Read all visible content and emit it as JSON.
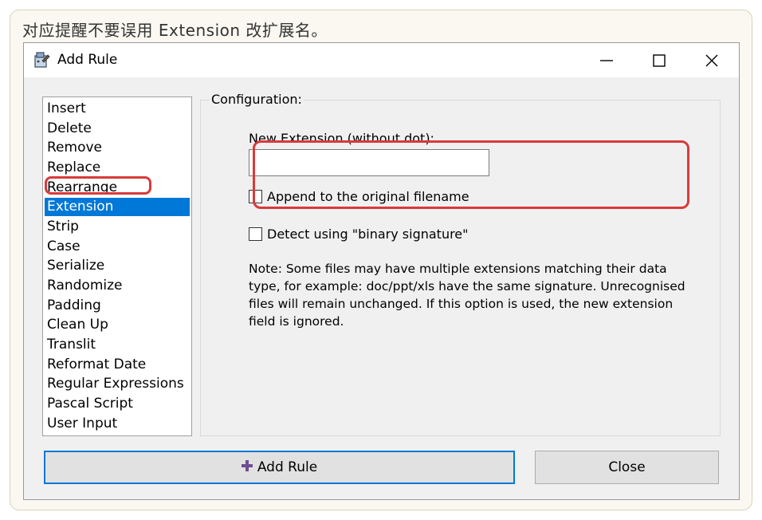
{
  "caption": "对应提醒不要误用 Extension 改扩展名。",
  "window": {
    "title": "Add Rule",
    "icon": "rule-wizard-icon",
    "controls": [
      "minimize-icon",
      "maximize-icon",
      "close-icon"
    ]
  },
  "rules": {
    "items": [
      "Insert",
      "Delete",
      "Remove",
      "Replace",
      "Rearrange",
      "Extension",
      "Strip",
      "Case",
      "Serialize",
      "Randomize",
      "Padding",
      "Clean Up",
      "Translit",
      "Reformat Date",
      "Regular Expressions",
      "Pascal Script",
      "User Input"
    ],
    "selected": "Extension",
    "selected_color": "#0078d7"
  },
  "config": {
    "group_label": "Configuration:",
    "new_extension_label": "New Extension (without dot):",
    "new_extension_value": "",
    "append_label": "Append to the original filename",
    "append_checked": false,
    "detect_label": "Detect using \"binary signature\"",
    "detect_checked": false,
    "note": "Note: Some files may have multiple extensions matching their data type, for example: doc/ppt/xls have the same signature. Unrecognised files will remain unchanged. If this option is used, the new extension field is ignored."
  },
  "buttons": {
    "add_rule": "Add Rule",
    "close": "Close"
  },
  "annotation_color": "#d93a3a"
}
